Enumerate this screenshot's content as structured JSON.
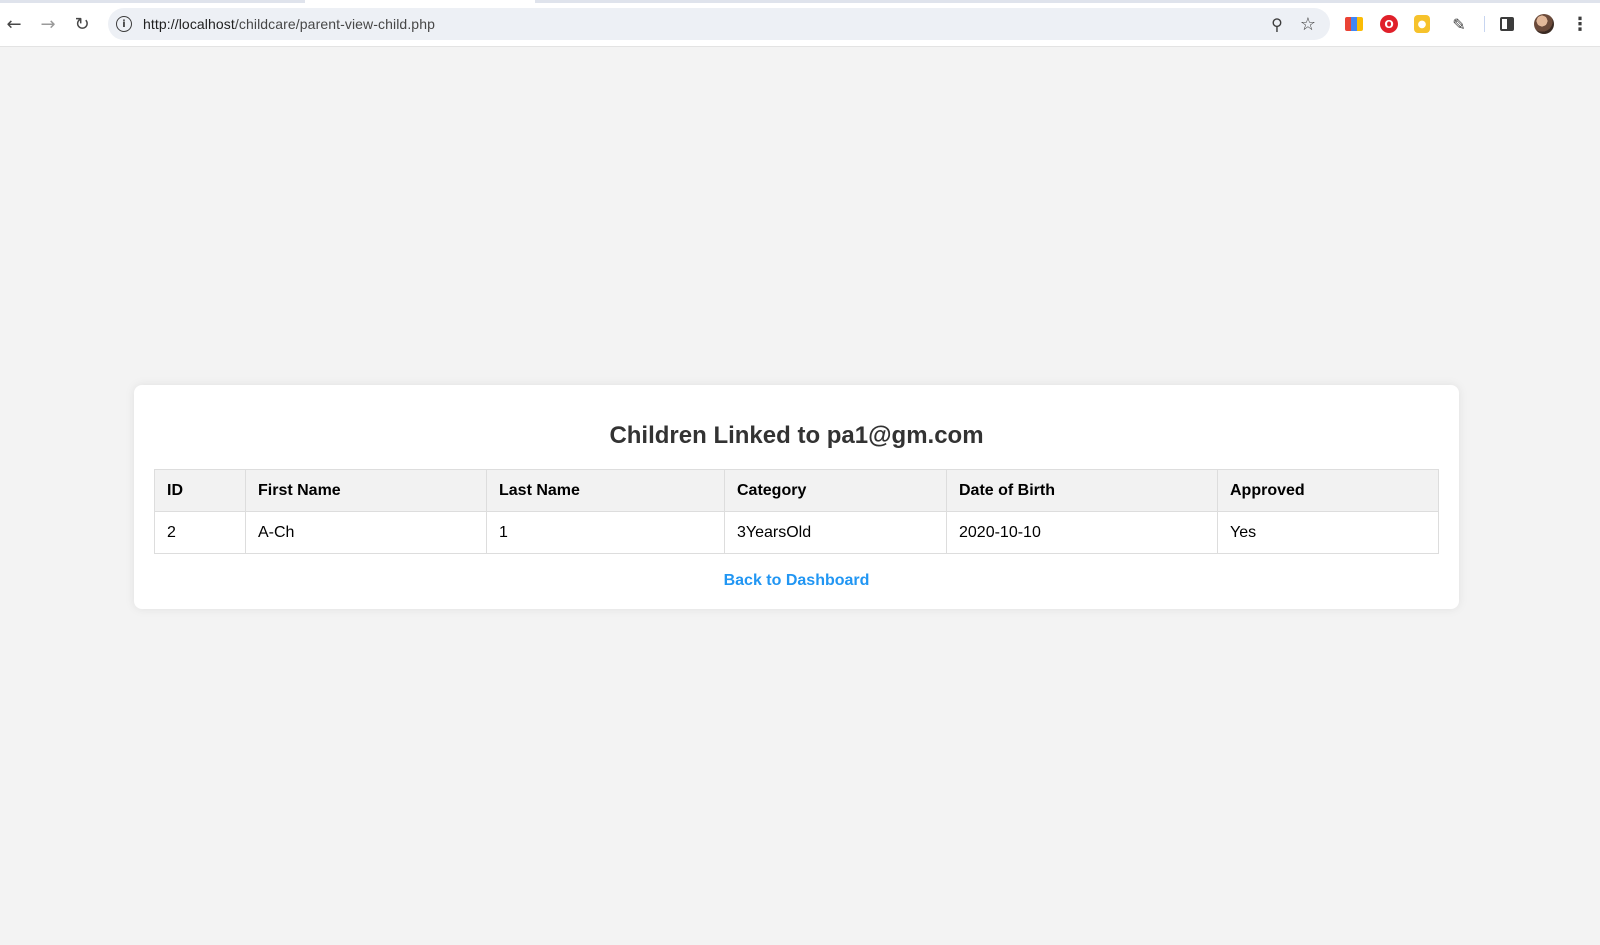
{
  "browser": {
    "url_host": "http://localhost",
    "url_path": "/childcare/parent-view-child.php",
    "back_icon": "arrow-left-icon",
    "forward_icon": "arrow-right-icon",
    "reload_icon": "reload-icon",
    "info_icon": "info-icon",
    "zoom_icon": "zoom-icon",
    "star_icon": "star-icon",
    "extensions": [
      "color-extension-icon",
      "opera-extension-icon",
      "yellow-extension-icon",
      "puzzle-icon"
    ],
    "side_panel_icon": "side-panel-icon",
    "menu_icon": "more-vertical-icon"
  },
  "page": {
    "title": "Children Linked to pa1@gm.com",
    "table": {
      "headers": [
        "ID",
        "First Name",
        "Last Name",
        "Category",
        "Date of Birth",
        "Approved"
      ],
      "rows": [
        [
          "2",
          "A-Ch",
          "1",
          "3YearsOld",
          "2020-10-10",
          "Yes"
        ]
      ]
    },
    "back_link": "Back to Dashboard",
    "link_color": "#2196f3"
  }
}
